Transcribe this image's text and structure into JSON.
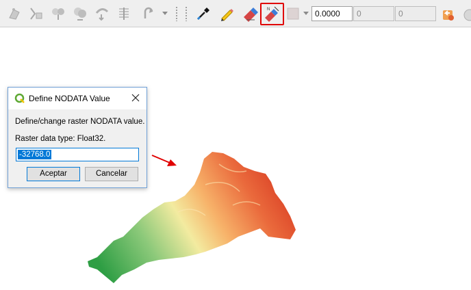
{
  "toolbar": {
    "x_value": "0.0000",
    "y_value": "0",
    "z_value": "0"
  },
  "dialog": {
    "title": "Define NODATA Value",
    "message": "Define/change raster NODATA value.",
    "data_type": "Raster data type: Float32.",
    "input_value": "-32768.0",
    "accept_label": "Aceptar",
    "cancel_label": "Cancelar"
  },
  "colors": {
    "highlight": "#e00000",
    "arrow": "#e00000",
    "selection": "#0078d7",
    "raster_low": "#2e9e44",
    "raster_mid": "#f3eba0",
    "raster_high": "#d83a22"
  },
  "icons": [
    "digitize-icon",
    "vertex-tool-icon",
    "split-features-icon",
    "merge-features-icon",
    "simplify-icon",
    "offset-icon",
    "rotate-icon",
    "eyedropper-icon",
    "pencil-icon",
    "eraser-icon",
    "nodata-tool-icon",
    "color-swatch-icon",
    "undo-icon"
  ]
}
